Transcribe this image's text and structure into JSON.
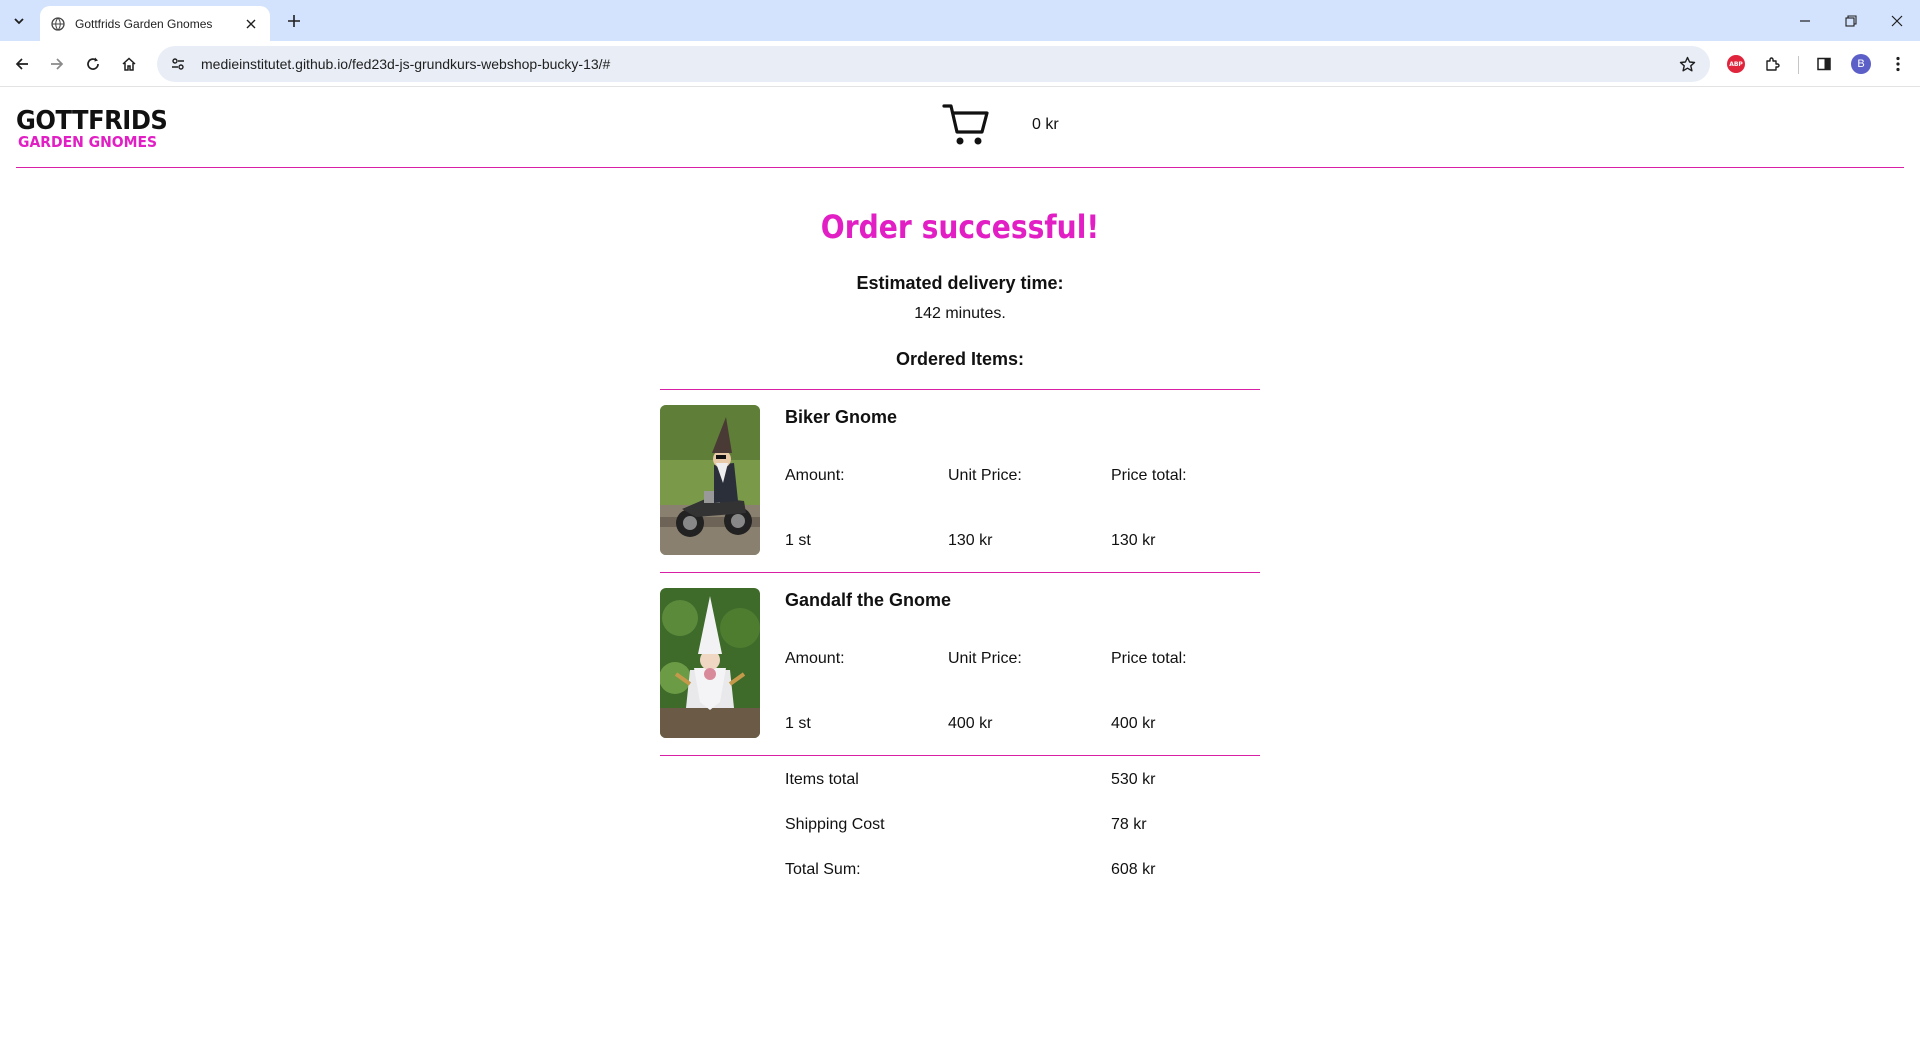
{
  "browser": {
    "tab_title": "Gottfrids Garden Gnomes",
    "url": "medieinstitutet.github.io/fed23d-js-grundkurs-webshop-bucky-13/#",
    "profile_initial": "B",
    "adblock_label": "ABP"
  },
  "header": {
    "logo_line1": "GOTTFRIDS",
    "logo_line2": "GARDEN GNOMES",
    "cart_total": "0 kr"
  },
  "order": {
    "title": "Order successful!",
    "delivery_label": "Estimated delivery time:",
    "delivery_value": "142 minutes.",
    "ordered_label": "Ordered Items:",
    "items": [
      {
        "name": "Biker Gnome",
        "amount_label": "Amount:",
        "unit_price_label": "Unit Price:",
        "price_total_label": "Price total:",
        "amount": "1 st",
        "unit_price": "130 kr",
        "price_total": "130 kr"
      },
      {
        "name": "Gandalf the Gnome",
        "amount_label": "Amount:",
        "unit_price_label": "Unit Price:",
        "price_total_label": "Price total:",
        "amount": "1 st",
        "unit_price": "400 kr",
        "price_total": "400 kr"
      }
    ],
    "summary": {
      "items_total_label": "Items total",
      "items_total": "530 kr",
      "shipping_label": "Shipping Cost",
      "shipping": "78 kr",
      "total_label": "Total Sum:",
      "total": "608 kr"
    }
  },
  "colors": {
    "accent": "#e11fc4",
    "divider": "#d81fa5",
    "tabbar": "#d3e3fd"
  },
  "icons": [
    "tab-list-icon",
    "globe-icon",
    "close-icon",
    "plus-icon",
    "minimize-icon",
    "restore-icon",
    "back-icon",
    "forward-icon",
    "reload-icon",
    "home-icon",
    "site-info-icon",
    "star-icon",
    "extensions-icon",
    "side-panel-icon",
    "more-icon",
    "cart-icon"
  ]
}
